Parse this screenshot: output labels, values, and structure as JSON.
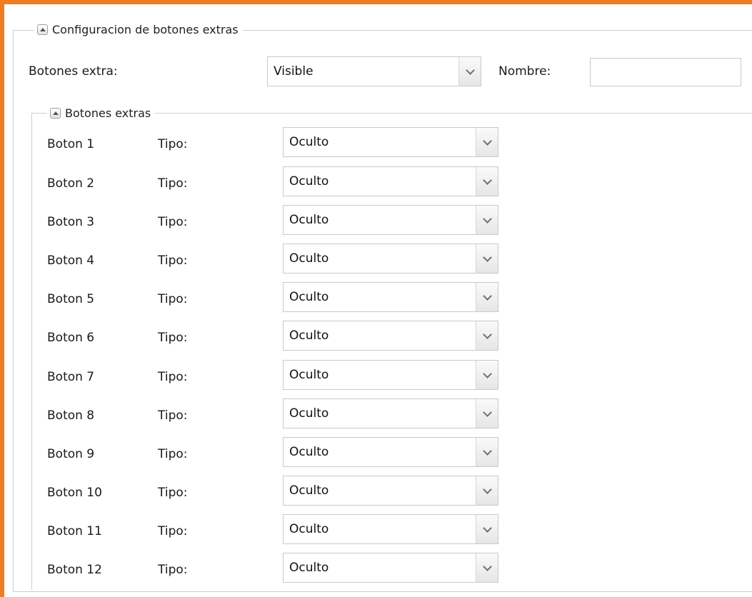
{
  "outer_section": {
    "title": "Configuracion de botones extras"
  },
  "extra_buttons": {
    "label": "Botones extra:",
    "value": "Visible",
    "name_label": "Nombre:",
    "name_value": ""
  },
  "inner_section": {
    "title": "Botones extras"
  },
  "buttons": [
    {
      "name": "Boton 1",
      "type_label": "Tipo:",
      "type_value": "Oculto"
    },
    {
      "name": "Boton 2",
      "type_label": "Tipo:",
      "type_value": "Oculto"
    },
    {
      "name": "Boton 3",
      "type_label": "Tipo:",
      "type_value": "Oculto"
    },
    {
      "name": "Boton 4",
      "type_label": "Tipo:",
      "type_value": "Oculto"
    },
    {
      "name": "Boton 5",
      "type_label": "Tipo:",
      "type_value": "Oculto"
    },
    {
      "name": "Boton 6",
      "type_label": "Tipo:",
      "type_value": "Oculto"
    },
    {
      "name": "Boton 7",
      "type_label": "Tipo:",
      "type_value": "Oculto"
    },
    {
      "name": "Boton 8",
      "type_label": "Tipo:",
      "type_value": "Oculto"
    },
    {
      "name": "Boton 9",
      "type_label": "Tipo:",
      "type_value": "Oculto"
    },
    {
      "name": "Boton 10",
      "type_label": "Tipo:",
      "type_value": "Oculto"
    },
    {
      "name": "Boton 11",
      "type_label": "Tipo:",
      "type_value": "Oculto"
    },
    {
      "name": "Boton 12",
      "type_label": "Tipo:",
      "type_value": "Oculto"
    }
  ],
  "colors": {
    "accent_border": "#ef7d24",
    "fieldset_border": "#cfcfcf"
  },
  "icons": {
    "collapse": "collapse-up-icon",
    "dropdown": "chevron-down-icon"
  }
}
